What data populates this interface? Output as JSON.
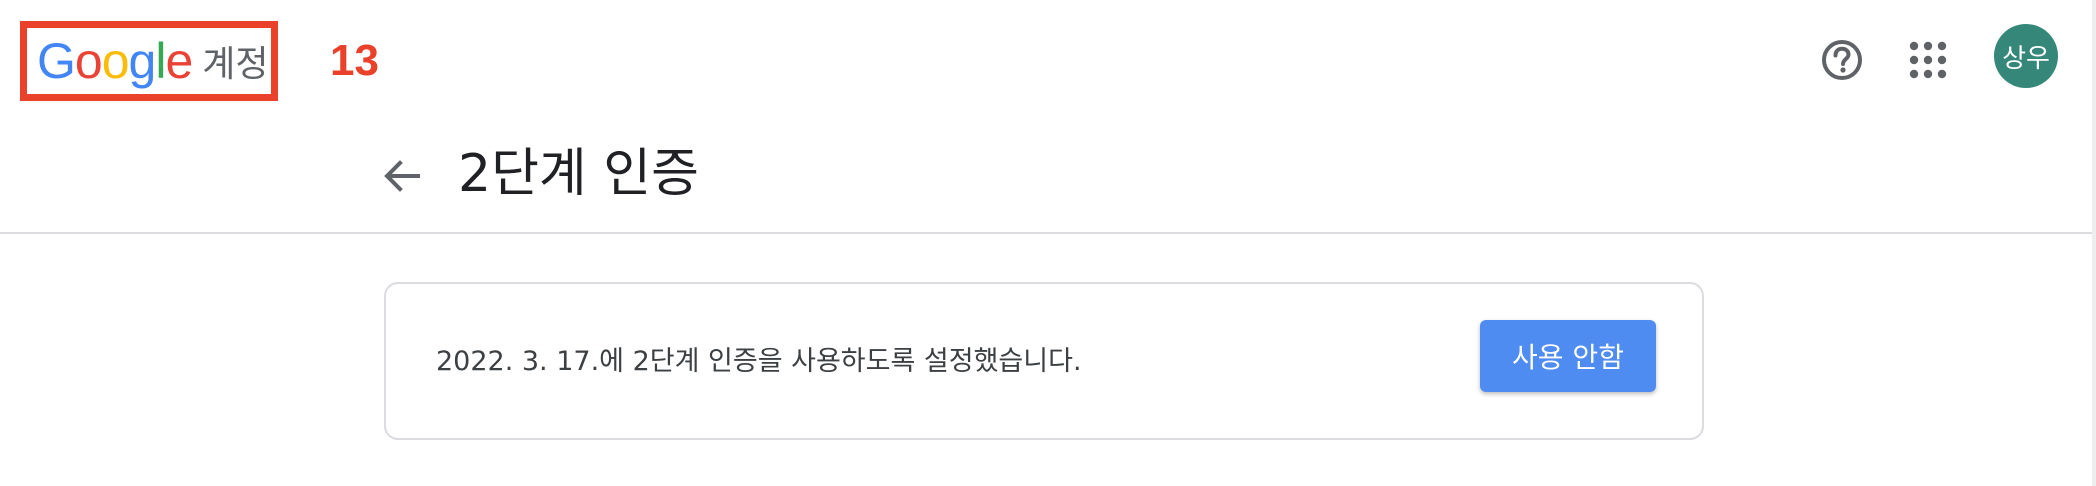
{
  "header": {
    "logo": {
      "letters": [
        "G",
        "o",
        "o",
        "g",
        "l",
        "e"
      ],
      "letter_colors": [
        "#4285f4",
        "#ea4335",
        "#fbbc05",
        "#4285f4",
        "#34a853",
        "#ea4335"
      ],
      "suffix": "계정"
    },
    "annotation_number": "13",
    "annotation_color": "#e9412a",
    "help_icon": "help-circle-icon",
    "apps_icon": "apps-grid-icon",
    "avatar_text": "상우",
    "avatar_color": "#35877a"
  },
  "title_bar": {
    "back_icon": "arrow-back-icon",
    "title": "2단계 인증"
  },
  "card": {
    "status_text": "2022. 3. 17.에 2단계 인증을 사용하도록 설정했습니다.",
    "button_label": "사용 안함",
    "button_color": "#4e8cf1"
  }
}
